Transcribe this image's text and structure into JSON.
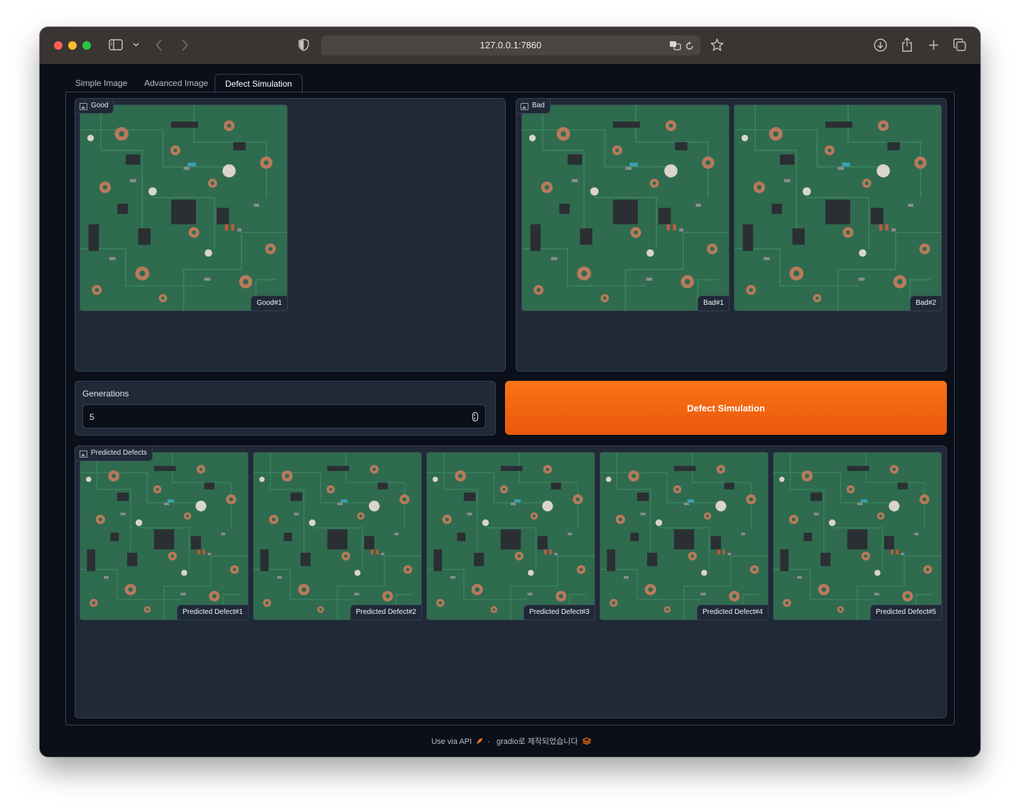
{
  "browser": {
    "url": "127.0.0.1:7860"
  },
  "tabs": [
    {
      "label": "Simple Image"
    },
    {
      "label": "Advanced Image"
    },
    {
      "label": "Defect Simulation",
      "active": true
    }
  ],
  "good_gallery": {
    "label": "Good",
    "items": [
      {
        "caption": "Good#1"
      }
    ]
  },
  "bad_gallery": {
    "label": "Bad",
    "items": [
      {
        "caption": "Bad#1"
      },
      {
        "caption": "Bad#2"
      }
    ]
  },
  "generations": {
    "label": "Generations",
    "value": "5"
  },
  "action_button": {
    "label": "Defect Simulation"
  },
  "predicted_gallery": {
    "label": "Predicted Defects",
    "items": [
      {
        "caption": "Predicted Defect#1"
      },
      {
        "caption": "Predicted Defect#2"
      },
      {
        "caption": "Predicted Defect#3"
      },
      {
        "caption": "Predicted Defect#4"
      },
      {
        "caption": "Predicted Defect#5"
      }
    ]
  },
  "footer": {
    "api_link": "Use via API",
    "separator": "·",
    "built_with": "gradio로 제작되었습니다"
  },
  "colors": {
    "window_bg": "#0b0f19",
    "block_bg": "#1f2937",
    "border": "#374151",
    "accent": "#f97316",
    "pcb_green": "#2f6b4f"
  },
  "icons": [
    "sidebar-icon",
    "chevron-down-icon",
    "back-icon",
    "forward-icon",
    "shield-icon",
    "translate-icon",
    "reload-icon",
    "star-icon",
    "download-icon",
    "share-icon",
    "plus-icon",
    "tabs-icon",
    "image-icon",
    "rocket-icon",
    "gradio-logo-icon"
  ]
}
